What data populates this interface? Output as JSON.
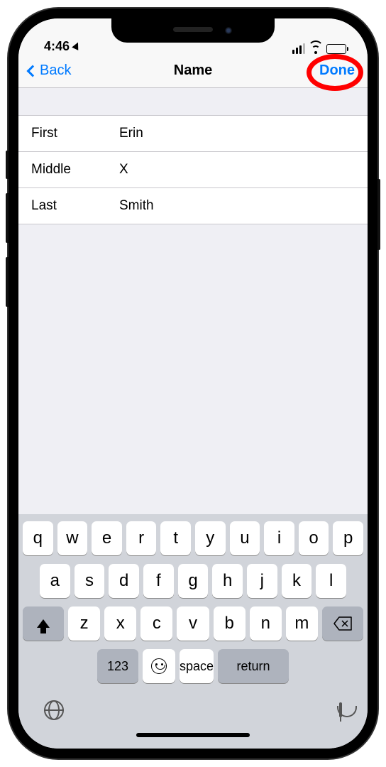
{
  "status": {
    "time": "4:46"
  },
  "nav": {
    "back": "Back",
    "title": "Name",
    "done": "Done"
  },
  "fields": {
    "first": {
      "label": "First",
      "value": "Erin"
    },
    "middle": {
      "label": "Middle",
      "value": "X"
    },
    "last": {
      "label": "Last",
      "value": "Smith"
    }
  },
  "keyboard": {
    "row1": [
      "q",
      "w",
      "e",
      "r",
      "t",
      "y",
      "u",
      "i",
      "o",
      "p"
    ],
    "row2": [
      "a",
      "s",
      "d",
      "f",
      "g",
      "h",
      "j",
      "k",
      "l"
    ],
    "row3": [
      "z",
      "x",
      "c",
      "v",
      "b",
      "n",
      "m"
    ],
    "numKey": "123",
    "space": "space",
    "return": "return"
  }
}
